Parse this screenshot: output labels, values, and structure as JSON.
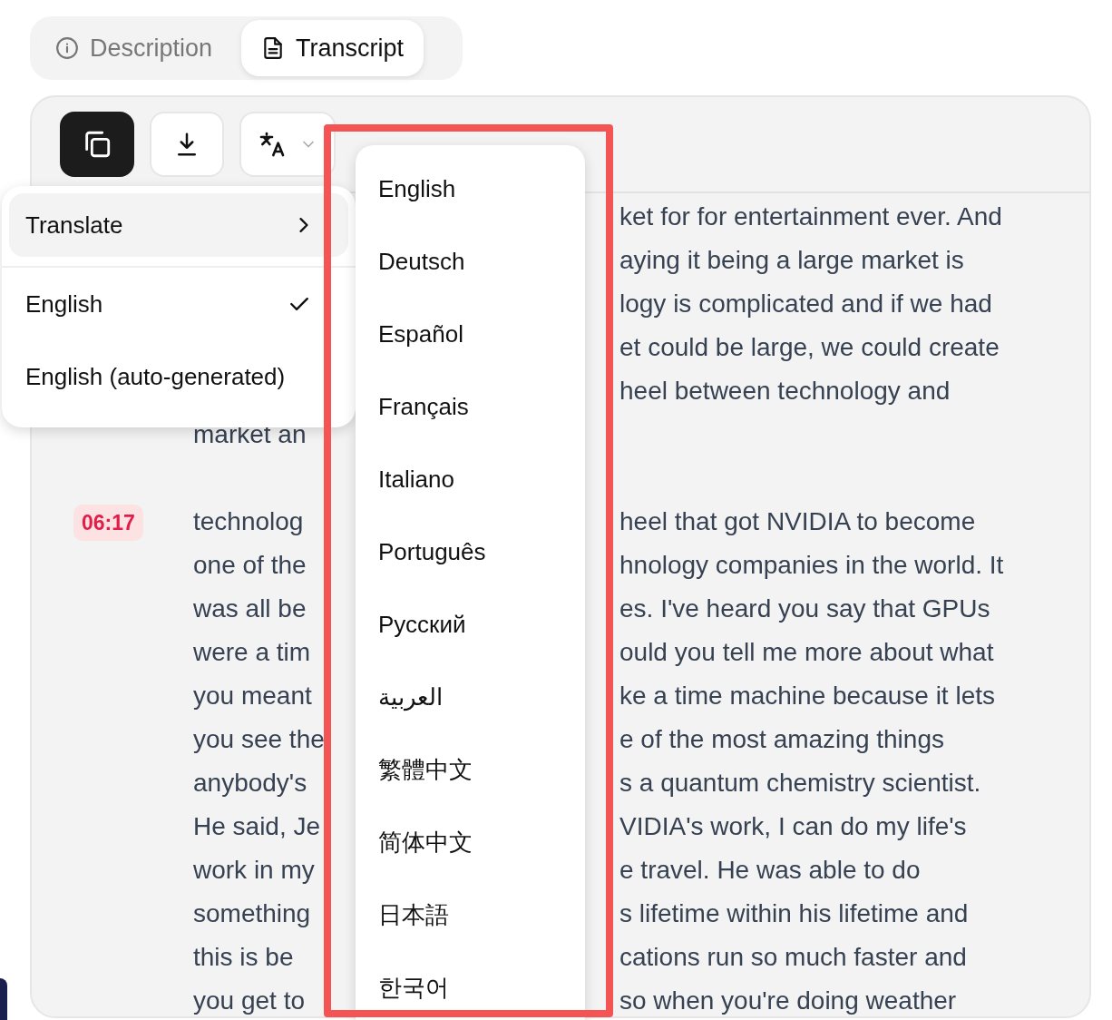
{
  "tabs": [
    {
      "label": "Description",
      "selected": false
    },
    {
      "label": "Transcript",
      "selected": true
    }
  ],
  "toolbar": {
    "buttons": [
      {
        "kind": "copy",
        "selected": true
      },
      {
        "kind": "download",
        "selected": false
      },
      {
        "kind": "translate",
        "selected": false
      }
    ]
  },
  "translate_menu": {
    "header": {
      "label": "Translate",
      "expanded": true
    },
    "items": [
      {
        "label": "English",
        "checked": true
      },
      {
        "label": "English (auto-generated)",
        "checked": false
      }
    ]
  },
  "language_submenu": {
    "items": [
      "English",
      "Deutsch",
      "Español",
      "Français",
      "Italiano",
      "Português",
      "Русский",
      "العربية",
      "繁體中文",
      "简体中文",
      "日本語",
      "한국어"
    ]
  },
  "transcript": {
    "segments": [
      {
        "lines": [
          {
            "right": "ket for for entertainment ever. And"
          },
          {
            "right": "aying it being a large market is"
          },
          {
            "right": "logy is complicated  and if we had"
          },
          {
            "right": "et could be large, we could create"
          },
          {
            "right": "heel between technology and"
          },
          {
            "left": "market an"
          }
        ]
      },
      {
        "time": "06:17",
        "lines": [
          {
            "left": "technolog",
            "right": "heel that  got NVIDIA to become"
          },
          {
            "left": "one of the",
            "right": "hnology companies in the world. It"
          },
          {
            "left": "was all  be",
            "right": "es. I've heard you say that GPUs"
          },
          {
            "left": "were a tim",
            "right": "ould you tell me  more about what"
          },
          {
            "left": "you meant",
            "right": "ke a time machine because it lets"
          },
          {
            "left": "you see the",
            "right": "e of the most amazing things"
          },
          {
            "left": "anybody's",
            "right": "s a quantum chemistry  scientist."
          },
          {
            "left": "He said, Je",
            "right": "VIDIA's work, I can do my life's"
          },
          {
            "left": "work in my",
            "right": "e travel. He was able to do"
          },
          {
            "left": "something",
            "right": "s lifetime within his lifetime and"
          },
          {
            "left": "this is  be",
            "right": "cations run so much faster and"
          },
          {
            "left": "you get to",
            "right": "so when you're  doing weather"
          }
        ]
      }
    ]
  }
}
